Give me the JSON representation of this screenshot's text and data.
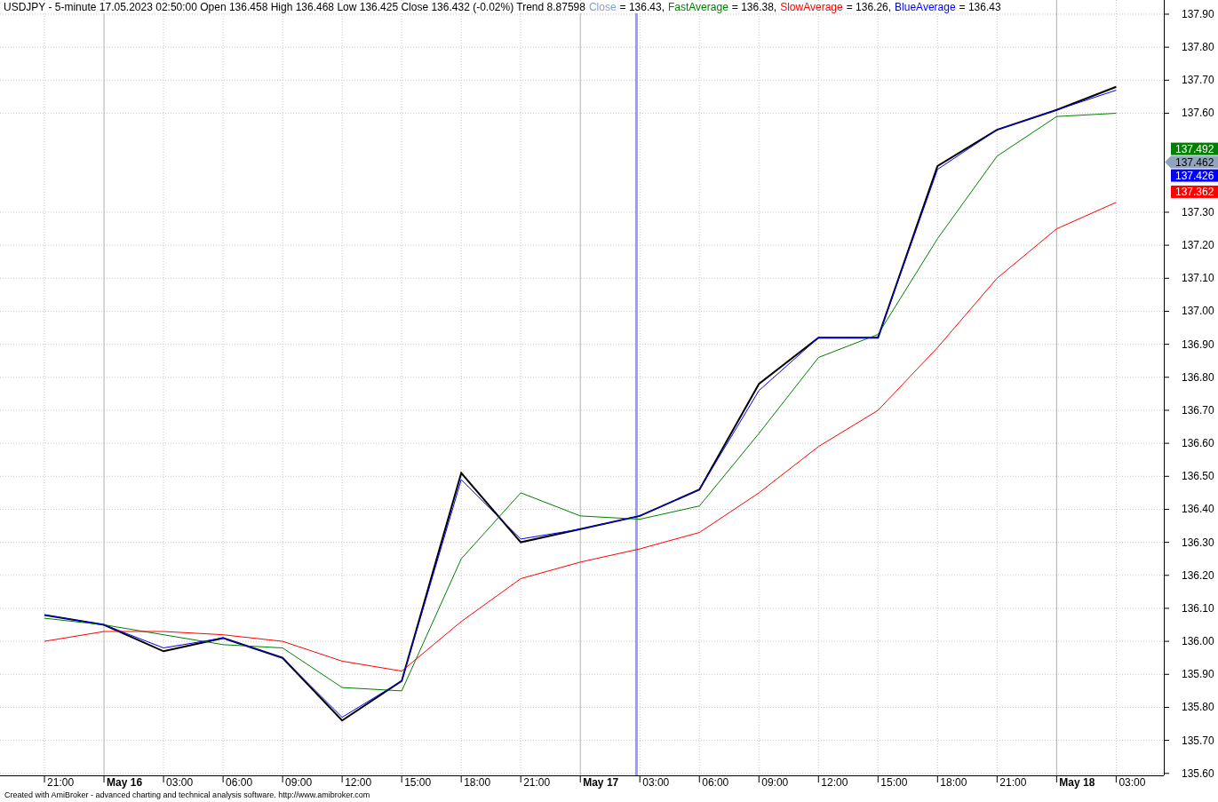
{
  "header": {
    "text": "USDJPY - 5-minute 17.05.2023 02:50:00 Open 136.458 High 136.468 Low 136.425 Close 136.432 (-0.02%) Trend 8.87598",
    "values": [
      {
        "color": "#7f9fcf",
        "value": "= 136.43,"
      },
      {
        "color": "#008000",
        "value": "= 136.38,"
      },
      {
        "color": "#ff0000",
        "value": "= 136.26,"
      },
      {
        "color": "#0000ff",
        "value": "= 136.43"
      }
    ]
  },
  "chart_data": {
    "type": "line",
    "ylim": [
      135.594,
      137.943
    ],
    "grid": true,
    "categories": [
      "21:00",
      "May 16",
      "03:00",
      "06:00",
      "09:00",
      "12:00",
      "15:00",
      "18:00",
      "21:00",
      "May 17",
      "03:00",
      "06:00",
      "09:00",
      "12:00",
      "15:00",
      "18:00",
      "21:00",
      "May 18",
      "03:00"
    ],
    "series": [
      {
        "name": "Close",
        "color": "#000000",
        "values": [
          136.08,
          136.05,
          135.97,
          136.01,
          135.95,
          135.76,
          135.88,
          136.51,
          136.3,
          136.34,
          136.38,
          136.46,
          136.78,
          136.92,
          136.92,
          137.44,
          137.55,
          137.61,
          137.68
        ]
      },
      {
        "name": "FastAverage",
        "color": "#008000",
        "values": [
          136.07,
          136.05,
          136.02,
          135.99,
          135.98,
          135.86,
          135.85,
          136.25,
          136.45,
          136.38,
          136.37,
          136.41,
          136.63,
          136.86,
          136.93,
          137.22,
          137.47,
          137.59,
          137.6
        ]
      },
      {
        "name": "SlowAverage",
        "color": "#ff0000",
        "values": [
          136.0,
          136.03,
          136.03,
          136.02,
          136.0,
          135.94,
          135.91,
          136.06,
          136.19,
          136.24,
          136.28,
          136.33,
          136.45,
          136.59,
          136.7,
          136.89,
          137.1,
          137.25,
          137.33
        ]
      },
      {
        "name": "BlueAverage",
        "color": "#0000ff",
        "values": [
          136.08,
          136.05,
          135.98,
          136.01,
          135.95,
          135.77,
          135.88,
          136.49,
          136.31,
          136.34,
          136.38,
          136.46,
          136.76,
          136.92,
          136.92,
          137.43,
          137.55,
          137.61,
          137.67
        ]
      }
    ],
    "yticks": [
      {
        "value": 135.6,
        "label": "135.60"
      },
      {
        "value": 135.7,
        "label": "135.70"
      },
      {
        "value": 135.8,
        "label": "135.80"
      },
      {
        "value": 135.9,
        "label": "135.90"
      },
      {
        "value": 136.0,
        "label": "136.00"
      },
      {
        "value": 136.1,
        "label": "136.10"
      },
      {
        "value": 136.2,
        "label": "136.20"
      },
      {
        "value": 136.3,
        "label": "136.30"
      },
      {
        "value": 136.4,
        "label": "136.40"
      },
      {
        "value": 136.5,
        "label": "136.50"
      },
      {
        "value": 136.6,
        "label": "136.60"
      },
      {
        "value": 136.7,
        "label": "136.70"
      },
      {
        "value": 136.8,
        "label": "136.80"
      },
      {
        "value": 136.9,
        "label": "136.90"
      },
      {
        "value": 137.0,
        "label": "137.00"
      },
      {
        "value": 137.1,
        "label": "137.10"
      },
      {
        "value": 137.2,
        "label": "137.20"
      },
      {
        "value": 137.3,
        "label": "137.30"
      },
      {
        "value": 137.6,
        "label": "137.60"
      },
      {
        "value": 137.7,
        "label": "137.70"
      },
      {
        "value": 137.8,
        "label": "137.80"
      },
      {
        "value": 137.9,
        "label": "137.90"
      }
    ]
  },
  "time_axis": [
    {
      "day": false
    },
    {
      "day": true
    },
    {
      "day": false
    },
    {
      "day": false
    },
    {
      "day": false
    },
    {
      "day": false
    },
    {
      "day": false
    },
    {
      "day": false
    },
    {
      "day": false
    },
    {
      "day": true
    },
    {
      "day": false
    },
    {
      "day": false
    },
    {
      "day": false
    },
    {
      "day": false
    },
    {
      "day": false
    },
    {
      "day": false
    },
    {
      "day": false
    },
    {
      "day": true
    },
    {
      "day": false
    }
  ],
  "price_tags": [
    {
      "text": "137.492",
      "color": "#008000",
      "pointer": false
    },
    {
      "text": "137.462",
      "color": "#8ea4bf",
      "pointer": true
    },
    {
      "text": "137.426",
      "color": "#0000ff",
      "pointer": false
    },
    {
      "text": "137.362",
      "color": "#ff0000",
      "pointer": false
    }
  ],
  "footer": "Created with AmiBroker - advanced charting and technical analysis software. http://www.amibroker.com"
}
